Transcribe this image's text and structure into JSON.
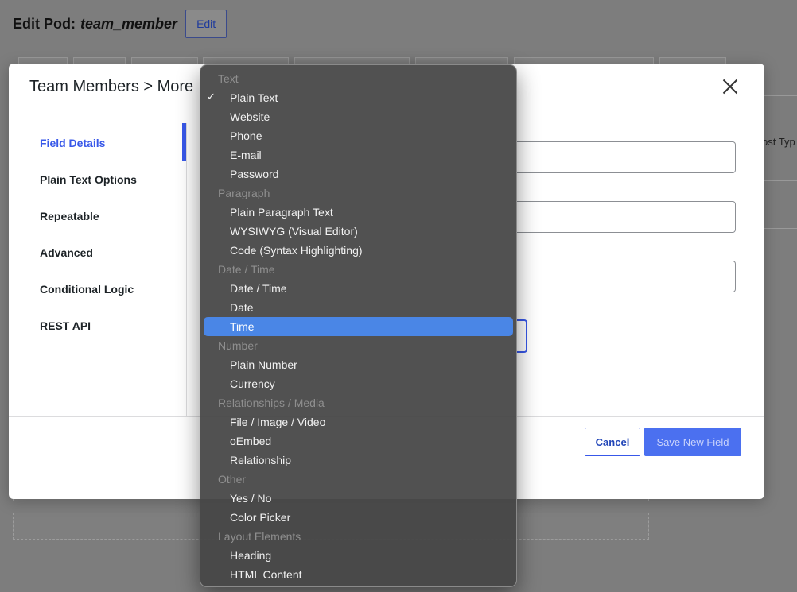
{
  "page": {
    "edit_pod_label": "Edit Pod:",
    "pod_name": "team_member",
    "edit_button": "Edit",
    "right_panel_text": "ost Typ"
  },
  "modal": {
    "title": "Team Members > More",
    "close_icon": "close-icon",
    "nav": [
      {
        "label": "Field Details",
        "active": true
      },
      {
        "label": "Plain Text Options",
        "active": false
      },
      {
        "label": "Repeatable",
        "active": false
      },
      {
        "label": "Advanced",
        "active": false
      },
      {
        "label": "Conditional Logic",
        "active": false
      },
      {
        "label": "REST API",
        "active": false
      }
    ],
    "cancel_button": "Cancel",
    "save_button": "Save New Field"
  },
  "dropdown": {
    "selected": "Plain Text",
    "highlighted": "Time",
    "check_icon": "checkmark-icon",
    "rows": [
      {
        "type": "group",
        "label": "Text"
      },
      {
        "type": "option",
        "label": "Plain Text"
      },
      {
        "type": "option",
        "label": "Website"
      },
      {
        "type": "option",
        "label": "Phone"
      },
      {
        "type": "option",
        "label": "E-mail"
      },
      {
        "type": "option",
        "label": "Password"
      },
      {
        "type": "group",
        "label": "Paragraph"
      },
      {
        "type": "option",
        "label": "Plain Paragraph Text"
      },
      {
        "type": "option",
        "label": "WYSIWYG (Visual Editor)"
      },
      {
        "type": "option",
        "label": "Code (Syntax Highlighting)"
      },
      {
        "type": "group",
        "label": "Date / Time"
      },
      {
        "type": "option",
        "label": "Date / Time"
      },
      {
        "type": "option",
        "label": "Date"
      },
      {
        "type": "option",
        "label": "Time"
      },
      {
        "type": "group",
        "label": "Number"
      },
      {
        "type": "option",
        "label": "Plain Number"
      },
      {
        "type": "option",
        "label": "Currency"
      },
      {
        "type": "group",
        "label": "Relationships / Media"
      },
      {
        "type": "option",
        "label": "File / Image / Video"
      },
      {
        "type": "option",
        "label": "oEmbed"
      },
      {
        "type": "option",
        "label": "Relationship"
      },
      {
        "type": "group",
        "label": "Other"
      },
      {
        "type": "option",
        "label": "Yes / No"
      },
      {
        "type": "option",
        "label": "Color Picker"
      },
      {
        "type": "group",
        "label": "Layout Elements"
      },
      {
        "type": "option",
        "label": "Heading"
      },
      {
        "type": "option",
        "label": "HTML Content"
      }
    ]
  }
}
